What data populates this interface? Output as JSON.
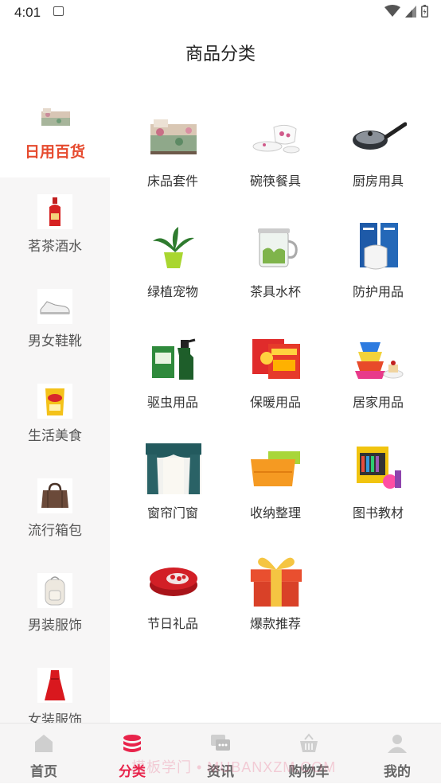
{
  "status": {
    "time": "4:01"
  },
  "header": {
    "title": "商品分类"
  },
  "sidebar": {
    "items": [
      {
        "label": "日用百货",
        "active": true,
        "icon": "bedding-image"
      },
      {
        "label": "茗茶酒水",
        "active": false,
        "icon": "liquor-bottle-image"
      },
      {
        "label": "男女鞋靴",
        "active": false,
        "icon": "sneaker-image"
      },
      {
        "label": "生活美食",
        "active": false,
        "icon": "tea-bag-image"
      },
      {
        "label": "流行箱包",
        "active": false,
        "icon": "handbag-image"
      },
      {
        "label": "男装服饰",
        "active": false,
        "icon": "backpack-image"
      },
      {
        "label": "女装服饰",
        "active": false,
        "icon": "red-dress-image"
      }
    ]
  },
  "grid": {
    "items": [
      {
        "label": "床品套件",
        "icon": "bed-set-image"
      },
      {
        "label": "碗筷餐具",
        "icon": "tableware-image"
      },
      {
        "label": "厨房用具",
        "icon": "frying-pan-image"
      },
      {
        "label": "绿植宠物",
        "icon": "potted-plant-image"
      },
      {
        "label": "茶具水杯",
        "icon": "tea-cup-image"
      },
      {
        "label": "防护用品",
        "icon": "mask-image"
      },
      {
        "label": "驱虫用品",
        "icon": "insect-spray-image"
      },
      {
        "label": "保暖用品",
        "icon": "heat-pack-image"
      },
      {
        "label": "居家用品",
        "icon": "silicone-cups-image"
      },
      {
        "label": "窗帘门窗",
        "icon": "curtain-image"
      },
      {
        "label": "收纳整理",
        "icon": "storage-box-image"
      },
      {
        "label": "图书教材",
        "icon": "paint-set-image"
      },
      {
        "label": "节日礼品",
        "icon": "gift-tin-image"
      },
      {
        "label": "爆款推荐",
        "icon": "gift-box-image"
      }
    ]
  },
  "tabbar": {
    "items": [
      {
        "label": "首页",
        "icon": "home-icon",
        "active": false
      },
      {
        "label": "分类",
        "icon": "category-stack-icon",
        "active": true
      },
      {
        "label": "资讯",
        "icon": "chat-icon",
        "active": false
      },
      {
        "label": "购物车",
        "icon": "cart-basket-icon",
        "active": false
      },
      {
        "label": "我的",
        "icon": "user-icon",
        "active": false
      }
    ]
  },
  "watermark": "模板学门 • MUBANXZM.COM",
  "colors": {
    "accent": "#e64a2e",
    "tab_active": "#e8234a",
    "sidebar_bg": "#f7f6f6"
  }
}
